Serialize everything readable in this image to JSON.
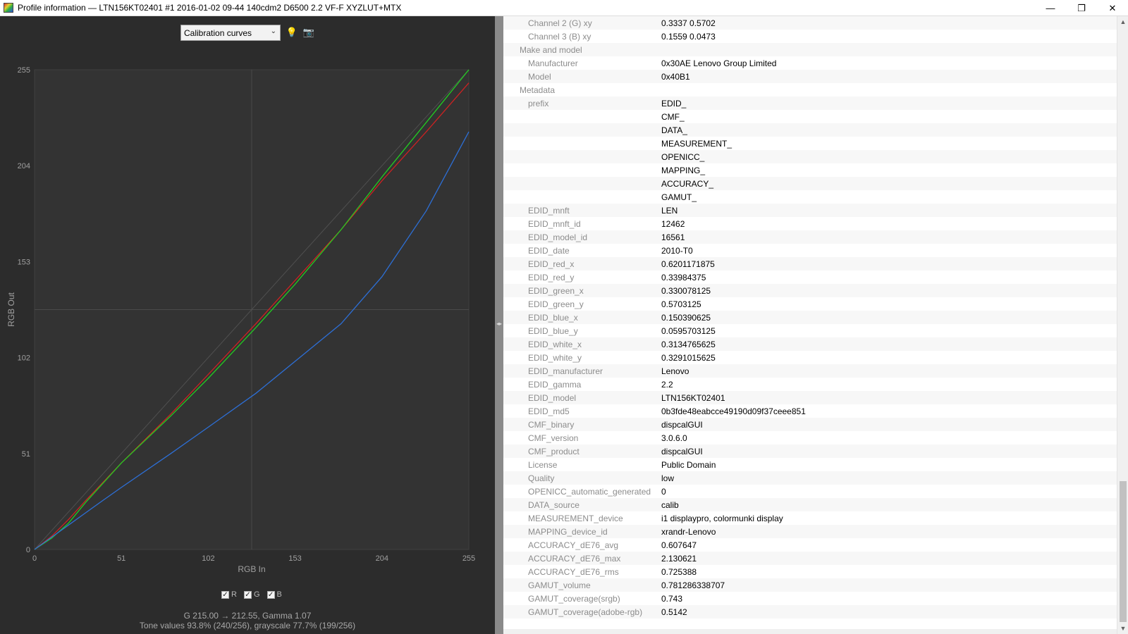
{
  "window": {
    "title": "Profile information — LTN156KT02401 #1 2016-01-02 09-44 140cdm2 D6500 2.2 VF-F XYZLUT+MTX",
    "minimize": "—",
    "restore": "❐",
    "close": "✕"
  },
  "toolbar": {
    "view_select": "Calibration curves",
    "bulb_icon": "💡",
    "screenshot_icon": "📷"
  },
  "chart_data": {
    "type": "line",
    "xlabel": "RGB In",
    "ylabel": "RGB Out",
    "xlim": [
      0,
      255
    ],
    "ylim": [
      0,
      255
    ],
    "xticks": [
      "0",
      "51",
      "102",
      "153",
      "204",
      "255"
    ],
    "yticks": [
      "0",
      "51",
      "102",
      "153",
      "204",
      "255"
    ],
    "grid": "crosshair",
    "series": [
      {
        "name": "R",
        "color": "#cc2222",
        "x": [
          0,
          10,
          20,
          30,
          51,
          80,
          102,
          130,
          153,
          180,
          204,
          230,
          255
        ],
        "y": [
          0,
          7,
          16,
          26,
          46,
          72,
          93,
          120,
          143,
          170,
          196,
          222,
          248
        ]
      },
      {
        "name": "G",
        "color": "#22cc22",
        "x": [
          0,
          10,
          20,
          30,
          51,
          80,
          102,
          130,
          153,
          180,
          204,
          230,
          255
        ],
        "y": [
          0,
          6,
          14,
          25,
          46,
          71,
          91,
          118,
          141,
          170,
          198,
          227,
          255
        ]
      },
      {
        "name": "B",
        "color": "#2d6fd6",
        "x": [
          0,
          20,
          40,
          51,
          80,
          102,
          130,
          153,
          180,
          204,
          230,
          255
        ],
        "y": [
          0,
          13,
          26,
          33,
          51,
          65,
          83,
          100,
          120,
          145,
          180,
          222
        ]
      }
    ]
  },
  "channels": {
    "r": "R",
    "g": "G",
    "b": "B"
  },
  "status": {
    "line1": "G 215.00 → 212.55, Gamma 1.07",
    "line2": "Tone values 93.8% (240/256), grayscale 77.7% (199/256)"
  },
  "info_rows": [
    {
      "key": "Channel 2 (G) xy",
      "value": "0.3337 0.5702",
      "level": 1
    },
    {
      "key": "Channel 3 (B) xy",
      "value": "0.1559 0.0473",
      "level": 1
    },
    {
      "key": "Make and model",
      "value": "",
      "level": 0
    },
    {
      "key": "Manufacturer",
      "value": "0x30AE Lenovo Group Limited",
      "level": 1
    },
    {
      "key": "Model",
      "value": "0x40B1",
      "level": 1
    },
    {
      "key": "Metadata",
      "value": "",
      "level": 0
    },
    {
      "key": "prefix",
      "value": "EDID_",
      "level": 1
    },
    {
      "key": "",
      "value": "CMF_",
      "level": 1
    },
    {
      "key": "",
      "value": "DATA_",
      "level": 1
    },
    {
      "key": "",
      "value": "MEASUREMENT_",
      "level": 1
    },
    {
      "key": "",
      "value": "OPENICC_",
      "level": 1
    },
    {
      "key": "",
      "value": "MAPPING_",
      "level": 1
    },
    {
      "key": "",
      "value": "ACCURACY_",
      "level": 1
    },
    {
      "key": "",
      "value": "GAMUT_",
      "level": 1
    },
    {
      "key": "EDID_mnft",
      "value": "LEN",
      "level": 1
    },
    {
      "key": "EDID_mnft_id",
      "value": "12462",
      "level": 1
    },
    {
      "key": "EDID_model_id",
      "value": "16561",
      "level": 1
    },
    {
      "key": "EDID_date",
      "value": "2010-T0",
      "level": 1
    },
    {
      "key": "EDID_red_x",
      "value": "0.6201171875",
      "level": 1
    },
    {
      "key": "EDID_red_y",
      "value": "0.33984375",
      "level": 1
    },
    {
      "key": "EDID_green_x",
      "value": "0.330078125",
      "level": 1
    },
    {
      "key": "EDID_green_y",
      "value": "0.5703125",
      "level": 1
    },
    {
      "key": "EDID_blue_x",
      "value": "0.150390625",
      "level": 1
    },
    {
      "key": "EDID_blue_y",
      "value": "0.0595703125",
      "level": 1
    },
    {
      "key": "EDID_white_x",
      "value": "0.3134765625",
      "level": 1
    },
    {
      "key": "EDID_white_y",
      "value": "0.3291015625",
      "level": 1
    },
    {
      "key": "EDID_manufacturer",
      "value": "Lenovo",
      "level": 1
    },
    {
      "key": "EDID_gamma",
      "value": "2.2",
      "level": 1
    },
    {
      "key": "EDID_model",
      "value": "LTN156KT02401",
      "level": 1
    },
    {
      "key": "EDID_md5",
      "value": "0b3fde48eabcce49190d09f37ceee851",
      "level": 1
    },
    {
      "key": "CMF_binary",
      "value": "dispcalGUI",
      "level": 1
    },
    {
      "key": "CMF_version",
      "value": "3.0.6.0",
      "level": 1
    },
    {
      "key": "CMF_product",
      "value": "dispcalGUI",
      "level": 1
    },
    {
      "key": "License",
      "value": "Public Domain",
      "level": 1
    },
    {
      "key": "Quality",
      "value": "low",
      "level": 1
    },
    {
      "key": "OPENICC_automatic_generated",
      "value": "0",
      "level": 1
    },
    {
      "key": "DATA_source",
      "value": "calib",
      "level": 1
    },
    {
      "key": "MEASUREMENT_device",
      "value": "i1 displaypro, colormunki display",
      "level": 1
    },
    {
      "key": "MAPPING_device_id",
      "value": "xrandr-Lenovo",
      "level": 1
    },
    {
      "key": "ACCURACY_dE76_avg",
      "value": "0.607647",
      "level": 1
    },
    {
      "key": "ACCURACY_dE76_max",
      "value": "2.130621",
      "level": 1
    },
    {
      "key": "ACCURACY_dE76_rms",
      "value": "0.725388",
      "level": 1
    },
    {
      "key": "GAMUT_volume",
      "value": "0.781286338707",
      "level": 1
    },
    {
      "key": "GAMUT_coverage(srgb)",
      "value": "0.743",
      "level": 1
    },
    {
      "key": "GAMUT_coverage(adobe-rgb)",
      "value": "0.5142",
      "level": 1
    }
  ]
}
